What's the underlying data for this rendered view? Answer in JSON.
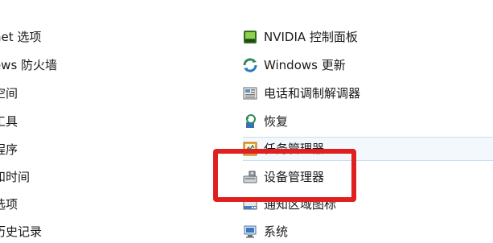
{
  "left_items": [
    {
      "label": "net 选项"
    },
    {
      "label": "ows 防火墙"
    },
    {
      "label": "空间"
    },
    {
      "label": "工具"
    },
    {
      "label": "程序"
    },
    {
      "label": "和时间"
    },
    {
      "label": "选项"
    },
    {
      "label": "历史记录"
    }
  ],
  "right_items": [
    {
      "label": "NVIDIA 控制面板",
      "icon": "nvidia-control-panel-icon"
    },
    {
      "label": "Windows 更新",
      "icon": "windows-update-icon"
    },
    {
      "label": "电话和调制解调器",
      "icon": "phone-modem-icon"
    },
    {
      "label": "恢复",
      "icon": "recovery-icon"
    },
    {
      "label": "任务管理器",
      "icon": "task-manager-icon"
    },
    {
      "label": "设备管理器",
      "icon": "device-manager-icon"
    },
    {
      "label": "通知区域图标",
      "icon": "notification-area-icon"
    },
    {
      "label": "系统",
      "icon": "system-icon"
    }
  ],
  "colors": {
    "highlight_border": "#e02020",
    "hover_row_border": "#c8dff0"
  }
}
